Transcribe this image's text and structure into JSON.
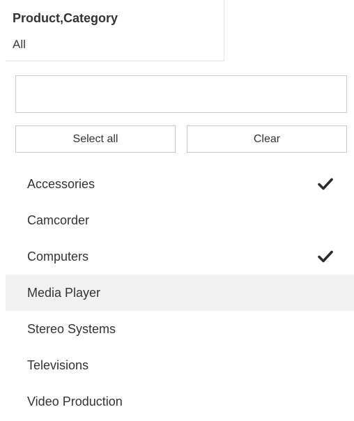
{
  "filter": {
    "title": "Product,Category",
    "selected_value": "All"
  },
  "search": {
    "value": "",
    "placeholder": ""
  },
  "buttons": {
    "select_all_label": "Select all",
    "clear_label": "Clear"
  },
  "items": [
    {
      "label": "Accessories",
      "checked": true,
      "hovered": false
    },
    {
      "label": "Camcorder",
      "checked": false,
      "hovered": false
    },
    {
      "label": "Computers",
      "checked": true,
      "hovered": false
    },
    {
      "label": "Media Player",
      "checked": false,
      "hovered": true
    },
    {
      "label": "Stereo Systems",
      "checked": false,
      "hovered": false
    },
    {
      "label": "Televisions",
      "checked": false,
      "hovered": false
    },
    {
      "label": "Video Production",
      "checked": false,
      "hovered": false
    }
  ],
  "icons": {
    "checked": "check-icon"
  },
  "colors": {
    "hover_background": "#f2f2f2",
    "text": "#333333",
    "border": "#cccccc"
  }
}
